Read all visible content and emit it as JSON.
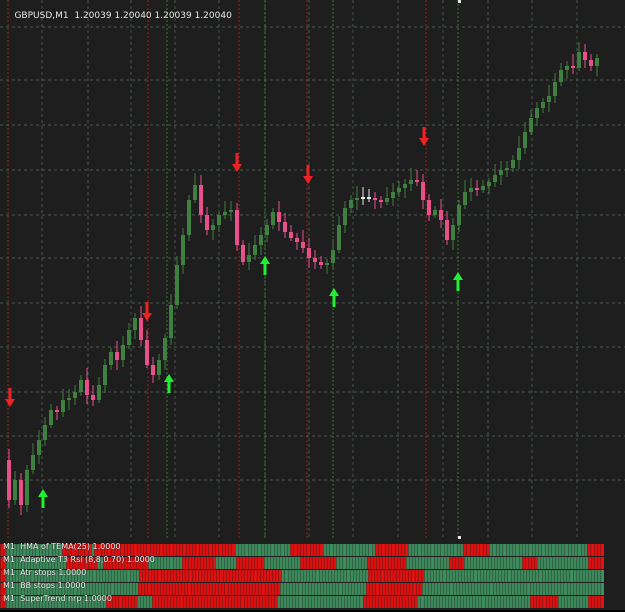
{
  "chart": {
    "symbol_label": "GBPUSD,M1",
    "ohlc": "1.20039 1.20040 1.20039 1.20040",
    "colors": {
      "background": "#1e1e1e",
      "grid": "#5a6a60",
      "bull": "#3f7f3f",
      "bear": "#e8508a",
      "doji": "#e6e6e6",
      "up_arrow": "#22ee33",
      "down_arrow": "#ee2222",
      "red_vline": "#c02020",
      "green_vline": "#3f8f3f"
    }
  },
  "indicator_panel": {
    "rows": [
      {
        "label": "M1  HMA of TEMA(25) 1.0000",
        "colors": "RRGGGGGGGGGGGGGGGGGRRRRRRRRRGRRRRRRRRRRRRRRRRRRRRRRRRRRRRRRRRRRRRRRRRRRRGGGGGGGGGGGGGGGGGRRRRRRRRRRGGGGGGGGGGGGGGGGRRRRRRRRRRGGGGGGGGGGGGGGGGGRRRRRRRRGGGGGGGGGGGGGGGGGGGGGGGGGGGGGGRRRRR"
      },
      {
        "label": "M1  Adaptive T3 Rsi (8,8,0.70) 1.0000",
        "colors": "RRGGGGGGGGGGGGGGGGGGGGRRRRRRRRRRGGRRRRRRRRRRRRRRRGGGGGGGGGGGRRRRRRRRRRRGGGGGGGRRRRRRRRRGGGGGGGGGGGGRRRRRRRRRRRRGGGGGGGGGGRRRRRRRRRRRRRGGGGGGGGGGGGGGRRRRRGGGGGGGGGGGGGGGGGGGRRRRRGGGGGGGGGGGGGGGGGRRRRR"
      },
      {
        "label": "M1  Atr stops 1.0000",
        "colors": "RRGGGGGGGGGGGGGGGGGGGGGGGGGGGGGGGGGGGGGGGGGGGRRRRRRRRRRRRRRRRRRRRRRRRRRRRRRRRRRRRRRRRRRRRRRGGGGGGGGGGGGGGGGGGGGGGGGGGGGRRRRRRRRRRRRRRRRRRGGGGGGGGGGGGGGGGGGGGGGGGGGGGGGGGGGGGGGGGGGGGGGGGGGGGGGGGGG"
      },
      {
        "label": "M1  BB stops 1.0000",
        "colors": "RRGGGGGGGGGGGGGGGGGGGGGGGGGGGGGGGGGGGGGGGGGGGRRRRRRRRRRRRRRRRRRRRRRRRRRRRRRRRRRRRRRRRRRRRRRGGGGGGGGGGGGGGGGGGGGGGGGGGGGRRRRRRRRRRRRRRRRRRGGGGGGGGGGGGGGGGGGGGGGGGGGGGGGGGGGGGGGGGGGGGGGGGGGGGGGGGGGG"
      },
      {
        "label": "M1  SuperTrend nrp 1.0000",
        "colors": "RRGGGGGGGGGGGGGGGGGGGGGGGGGGGGGGGGGRRRRRRRRRRGGGGGRRRRRRRRRRRRRRRRRRRRRRRRRRRRRRRRRRRRRRRRRGGGGGGGGGGGGGGGGGGGGGGGGGGGGRRRRRRRRRRRRRRRRRRGGGGGGGGGGGGGGGGGGGGGGGGGGGGGGGGGGGGGRRRRRRRRRGGGGGGGGGGRRRRR"
      }
    ],
    "colors": {
      "green": "#3f8f5f",
      "red": "#e81010",
      "border": "#1e1e1e"
    }
  }
}
